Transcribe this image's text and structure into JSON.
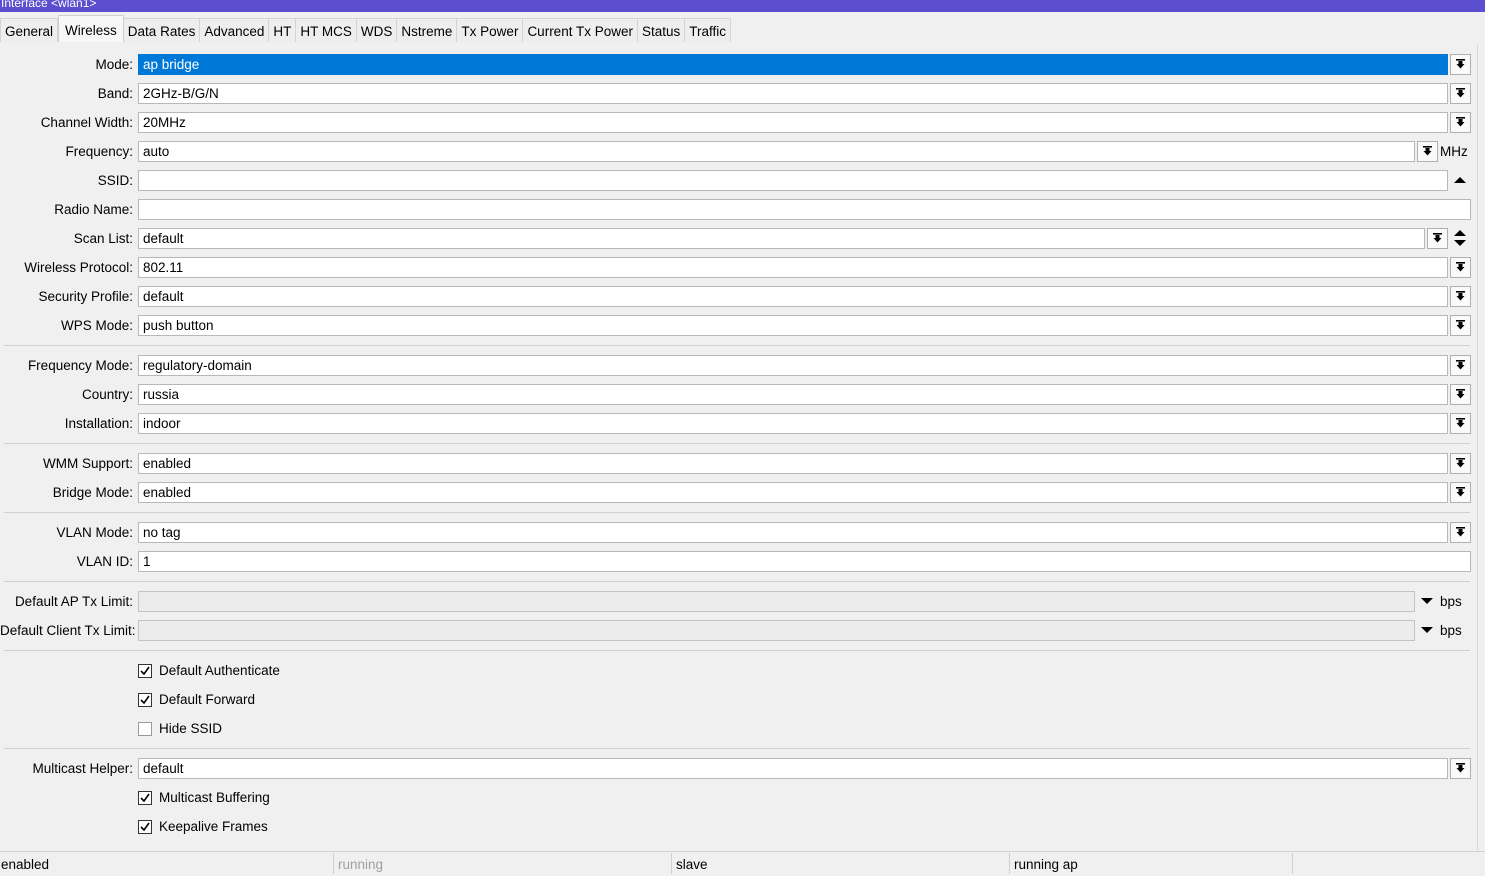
{
  "window": {
    "title": "Interface <wlan1>"
  },
  "tabs": [
    "General",
    "Wireless",
    "Data Rates",
    "Advanced",
    "HT",
    "HT MCS",
    "WDS",
    "Nstreme",
    "Tx Power",
    "Current Tx Power",
    "Status",
    "Traffic"
  ],
  "active_tab": "Wireless",
  "fields": {
    "mode": {
      "label": "Mode:",
      "value": "ap bridge"
    },
    "band": {
      "label": "Band:",
      "value": "2GHz-B/G/N"
    },
    "channel_width": {
      "label": "Channel Width:",
      "value": "20MHz"
    },
    "frequency": {
      "label": "Frequency:",
      "value": "auto",
      "unit": "MHz"
    },
    "ssid": {
      "label": "SSID:",
      "value": ""
    },
    "radio_name": {
      "label": "Radio Name:",
      "value": ""
    },
    "scan_list": {
      "label": "Scan List:",
      "value": "default"
    },
    "wireless_protocol": {
      "label": "Wireless Protocol:",
      "value": "802.11"
    },
    "security_profile": {
      "label": "Security Profile:",
      "value": "default"
    },
    "wps_mode": {
      "label": "WPS Mode:",
      "value": "push button"
    },
    "frequency_mode": {
      "label": "Frequency Mode:",
      "value": "regulatory-domain"
    },
    "country": {
      "label": "Country:",
      "value": "russia"
    },
    "installation": {
      "label": "Installation:",
      "value": "indoor"
    },
    "wmm_support": {
      "label": "WMM Support:",
      "value": "enabled"
    },
    "bridge_mode": {
      "label": "Bridge Mode:",
      "value": "enabled"
    },
    "vlan_mode": {
      "label": "VLAN Mode:",
      "value": "no tag"
    },
    "vlan_id": {
      "label": "VLAN ID:",
      "value": "1"
    },
    "default_ap_tx_limit": {
      "label": "Default AP Tx Limit:",
      "value": "",
      "unit": "bps"
    },
    "default_client_tx_limit": {
      "label": "Default Client Tx Limit:",
      "value": "",
      "unit": "bps"
    },
    "multicast_helper": {
      "label": "Multicast Helper:",
      "value": "default"
    }
  },
  "checkboxes": {
    "default_authenticate": {
      "label": "Default Authenticate",
      "checked": true
    },
    "default_forward": {
      "label": "Default Forward",
      "checked": true
    },
    "hide_ssid": {
      "label": "Hide SSID",
      "checked": false
    },
    "multicast_buffering": {
      "label": "Multicast Buffering",
      "checked": true
    },
    "keepalive_frames": {
      "label": "Keepalive Frames",
      "checked": true
    }
  },
  "status": [
    "enabled",
    "running",
    "slave",
    "running ap"
  ]
}
